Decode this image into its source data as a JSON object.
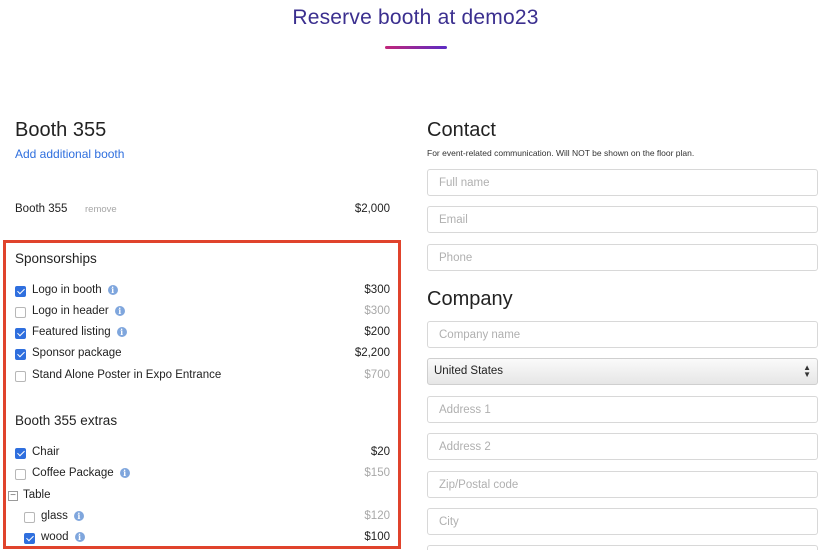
{
  "header": {
    "title": "Reserve booth at demo23"
  },
  "booth": {
    "title": "Booth 355",
    "add_link": "Add additional booth",
    "line": {
      "name": "Booth 355",
      "remove": "remove",
      "price": "$2,000"
    }
  },
  "sponsorships": {
    "title": "Sponsorships",
    "items": [
      {
        "label": "Logo in booth",
        "price": "$300",
        "checked": true,
        "info": true
      },
      {
        "label": "Logo in header",
        "price": "$300",
        "checked": false,
        "info": true
      },
      {
        "label": "Featured listing",
        "price": "$200",
        "checked": true,
        "info": true
      },
      {
        "label": "Sponsor package",
        "price": "$2,200",
        "checked": true,
        "info": false
      },
      {
        "label": "Stand Alone Poster in Expo Entrance",
        "price": "$700",
        "checked": false,
        "info": false
      }
    ]
  },
  "extras": {
    "title": "Booth 355 extras",
    "items": [
      {
        "label": "Chair",
        "price": "$20",
        "checked": true,
        "info": false
      },
      {
        "label": "Coffee Package",
        "price": "$150",
        "checked": false,
        "info": true
      }
    ],
    "table": {
      "label": "Table",
      "toggle": "−",
      "items": [
        {
          "label": "glass",
          "price": "$120",
          "checked": false,
          "info": true
        },
        {
          "label": "wood",
          "price": "$100",
          "checked": true,
          "info": true
        }
      ]
    }
  },
  "info_glyph": "i",
  "contact": {
    "title": "Contact",
    "subtitle": "For event-related communication. Will NOT be shown on the floor plan.",
    "fields": {
      "full_name": "Full name",
      "email": "Email",
      "phone": "Phone"
    }
  },
  "company": {
    "title": "Company",
    "fields": {
      "company_name": "Company name",
      "country": "United States",
      "address1": "Address 1",
      "address2": "Address 2",
      "zip": "Zip/Postal code",
      "city": "City"
    }
  },
  "colors": {
    "accent": "#2f6fde",
    "title": "#3b2f8f",
    "highlight": "#e0432c"
  }
}
